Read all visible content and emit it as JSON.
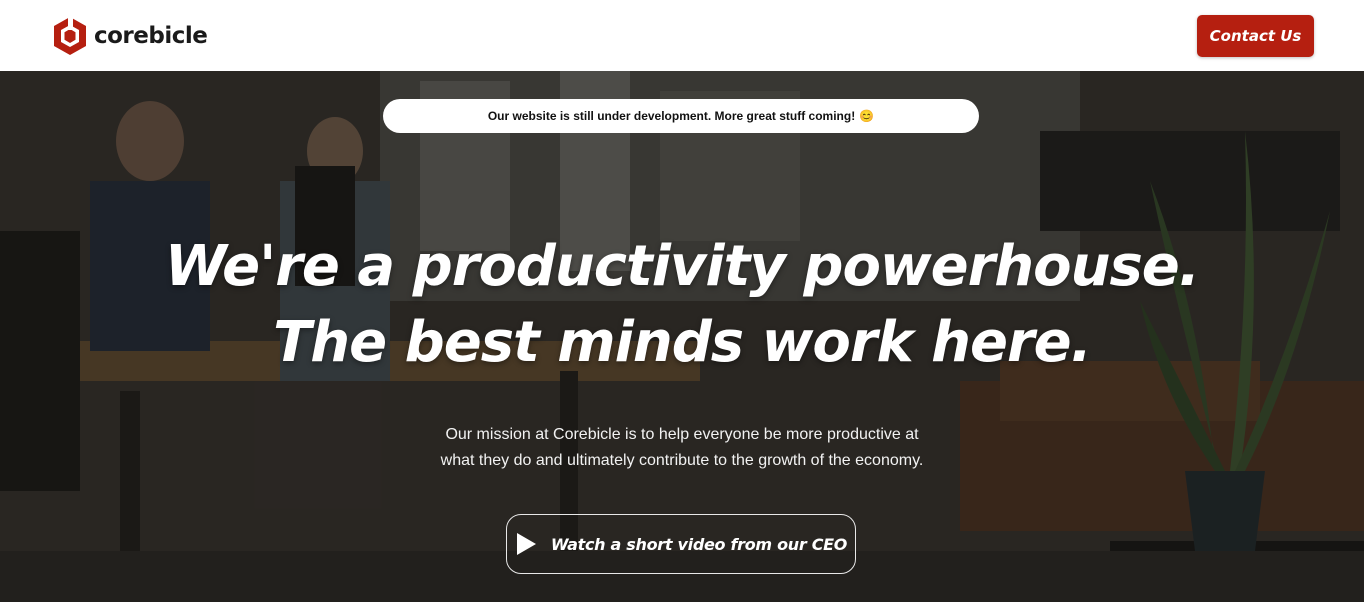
{
  "header": {
    "brand_name": "corebicle",
    "logo_icon": "hexagon-logo-icon",
    "contact_label": "Contact Us"
  },
  "banner": {
    "text": "Our website is still under development. More great stuff coming!",
    "emoji": "😊"
  },
  "hero": {
    "headline_line1": "We're a productivity powerhouse.",
    "headline_line2": "The best minds work here.",
    "mission_line1": "Our mission at Corebicle is to help everyone be more productive at",
    "mission_line2": "what they do and ultimately contribute to the growth of the economy.",
    "video_label": "Watch a short video from our CEO",
    "video_icon": "play-icon"
  },
  "colors": {
    "brand": "#b51f10",
    "header_bg": "#ffffff",
    "hero_text": "#ffffff"
  }
}
